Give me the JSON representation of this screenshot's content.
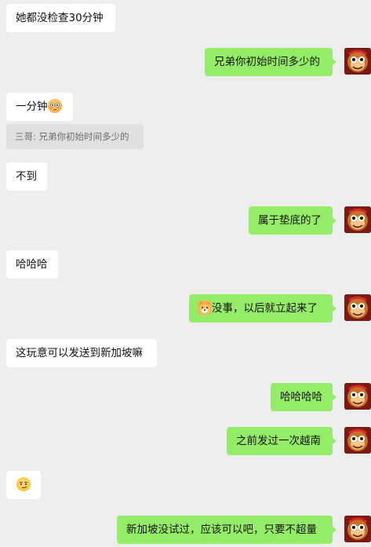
{
  "messages": [
    {
      "side": "left",
      "text": "她都没检查30分钟"
    },
    {
      "side": "right",
      "text": "兄弟你初始时间多少的"
    },
    {
      "side": "left",
      "text": "一分钟",
      "emoji": "flushed-face-icon"
    },
    {
      "side": "left",
      "quote": "三哥: 兄弟你初始时间多少的"
    },
    {
      "side": "left",
      "text": "不到"
    },
    {
      "side": "right",
      "text": "属于垫底的了"
    },
    {
      "side": "left",
      "text": "哈哈哈"
    },
    {
      "side": "right",
      "text": "没事，以后就立起来了",
      "emoji": "doge-icon"
    },
    {
      "side": "left",
      "text": "这玩意可以发送到新加坡嘛"
    },
    {
      "side": "right",
      "text": "哈哈哈哈"
    },
    {
      "side": "right",
      "text": "之前发过一次越南"
    },
    {
      "side": "left",
      "text": "",
      "emoji": "smirk-face-icon"
    },
    {
      "side": "right",
      "text": "新加坡没试过，应该可以吧，只要不超量"
    }
  ],
  "colors": {
    "background": "#ededed",
    "sent_bubble": "#95ec69",
    "received_bubble": "#ffffff",
    "quote_bg": "#e0e0e0"
  }
}
